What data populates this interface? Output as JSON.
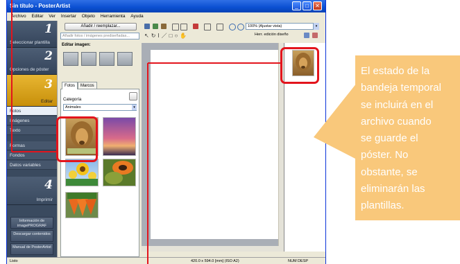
{
  "window": {
    "title": "Sin título - PosterArtist",
    "controls": {
      "minimize": "_",
      "maximize": "□",
      "close": "✕"
    }
  },
  "menu": [
    "Archivo",
    "Editar",
    "Ver",
    "Insertar",
    "Objeto",
    "Herramienta",
    "Ayuda"
  ],
  "nav": {
    "steps": [
      {
        "num": "1",
        "label": "Seleccionar plantilla"
      },
      {
        "num": "2",
        "label": "Opciones de póster"
      },
      {
        "num": "3",
        "label": "Editar"
      },
      {
        "num": "4",
        "label": "Imprimir"
      }
    ],
    "subitems": [
      "Fotos",
      "Imágenes prediseñadas",
      "Texto",
      "Formas",
      "Fondos",
      "Datos variables"
    ],
    "bottom_buttons": [
      "Información de imagePROGRAF",
      "Descargar contenidos",
      "Manual de PosterArtist"
    ]
  },
  "panel": {
    "add_button": "Añadir / reemplazar...",
    "search_placeholder": "Añadir fotos / imágenes prediseñadas...",
    "edit_image_label": "Editar imagen:",
    "tabs": [
      "Fotos",
      "Marcos"
    ],
    "category_label": "Categoría",
    "category_value": "Animales"
  },
  "toolbar": {
    "zoom_value": "100% (Ajustar vista)",
    "trim_label": "Herr. edición diseño"
  },
  "status": {
    "left": "Listo",
    "size": "420.0 x 594.0 [mm] (ISO A2)",
    "right": "NUM  DESP"
  },
  "callout": {
    "lines": [
      "El estado de la",
      "bandeja temporal",
      "se incluirá en el",
      "archivo cuando",
      "se guarde el",
      "póster. No",
      "obstante, se",
      "eliminarán las",
      "plantillas."
    ],
    "bg_color": "#f9c87b",
    "highlight_color": "#e3141c"
  }
}
